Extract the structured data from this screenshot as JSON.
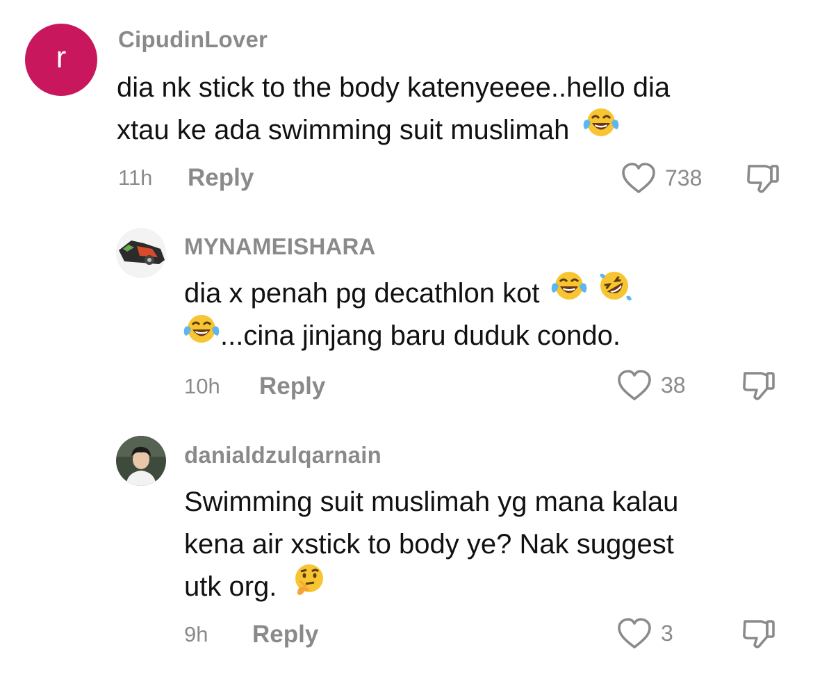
{
  "colors": {
    "avatar_bg": "#c8175d",
    "meta_text": "#8a8a8a",
    "body_text": "#111111"
  },
  "comments": [
    {
      "avatar_letter": "r",
      "username": "CipudinLover",
      "lines": [
        "dia nk stick to the body katenyeeee..hello dia",
        "xtau ke ada swimming suit muslimah"
      ],
      "emojis": [
        "face-with-tears-of-joy"
      ],
      "time": "11h",
      "reply_label": "Reply",
      "likes": "738"
    },
    {
      "avatar_icon": "car-photo-avatar",
      "username": "MYNAMEISHARA",
      "lines": [
        "dia x penah pg decathlon kot",
        "...cina jinjang baru duduk condo."
      ],
      "emojis": [
        "face-with-tears-of-joy",
        "rolling-on-floor-laughing",
        "face-with-tears-of-joy"
      ],
      "time": "10h",
      "reply_label": "Reply",
      "likes": "38"
    },
    {
      "avatar_icon": "person-photo-avatar",
      "username": "danialdzulqarnain",
      "lines": [
        "Swimming suit muslimah yg mana kalau",
        "kena air xstick to body ye? Nak suggest",
        "utk org."
      ],
      "emojis": [
        "thinking-face"
      ],
      "time": "9h",
      "reply_label": "Reply",
      "likes": "3"
    }
  ]
}
